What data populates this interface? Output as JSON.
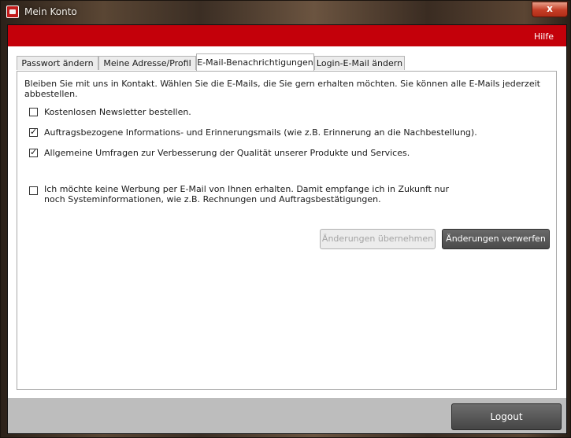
{
  "window": {
    "title": "Mein Konto",
    "close_symbol": "x",
    "app_icon": "app-icon"
  },
  "header": {
    "help_label": "Hilfe",
    "color": "#c4000a"
  },
  "tabs": [
    {
      "label": "Passwort ändern",
      "active": false
    },
    {
      "label": "Meine Adresse/Profil",
      "active": false
    },
    {
      "label": "E-Mail-Benachrichtigungen",
      "active": true
    },
    {
      "label": "Login-E-Mail ändern",
      "active": false
    }
  ],
  "panel": {
    "intro": "Bleiben Sie mit uns in Kontakt. Wählen Sie die E-Mails, die Sie gern erhalten möchten. Sie können alle E-Mails jederzeit abbestellen.",
    "options": [
      {
        "label": "Kostenlosen Newsletter bestellen.",
        "checked": false
      },
      {
        "label": "Auftragsbezogene Informations- und Erinnerungsmails (wie z.B. Erinnerung an die Nachbestellung).",
        "checked": true
      },
      {
        "label": "Allgemeine Umfragen zur Verbesserung der Qualität unserer Produkte und Services.",
        "checked": true
      },
      {
        "label": "Ich möchte keine Werbung per E-Mail von Ihnen erhalten. Damit empfange ich in Zukunft nur noch Systeminformationen, wie z.B. Rechnungen und Auftragsbestätigungen.",
        "checked": false
      }
    ],
    "apply_label": "Änderungen übernehmen",
    "apply_enabled": false,
    "discard_label": "Änderungen verwerfen"
  },
  "footer": {
    "logout_label": "Logout"
  }
}
